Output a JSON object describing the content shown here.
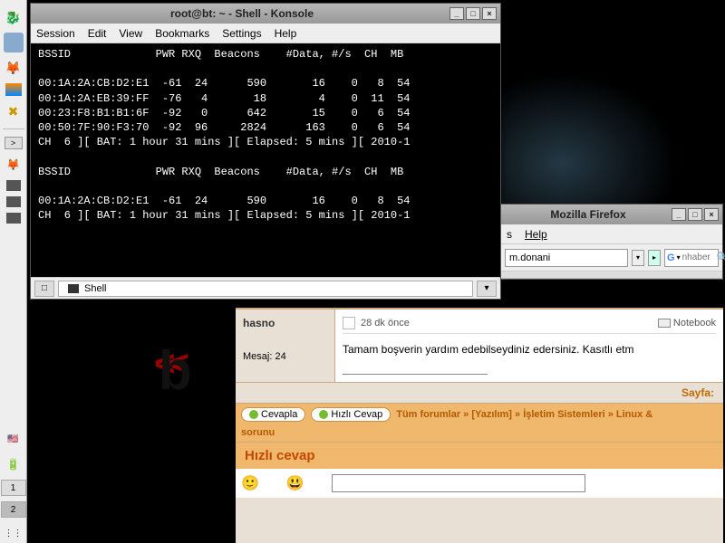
{
  "taskbar": {
    "desktops": [
      "1",
      "2"
    ]
  },
  "konsole": {
    "title": "root@bt: ~ - Shell - Konsole",
    "menu": [
      "Session",
      "Edit",
      "View",
      "Bookmarks",
      "Settings",
      "Help"
    ],
    "tab": "Shell",
    "lines": [
      "BSSID             PWR RXQ  Beacons    #Data, #/s  CH  MB",
      "",
      "00:1A:2A:CB:D2:E1  -61  24      590       16    0   8  54",
      "00:1A:2A:EB:39:FF  -76   4       18        4    0  11  54",
      "00:23:F8:B1:B1:6F  -92   0      642       15    0   6  54",
      "00:50:7F:90:F3:70  -92  96     2824      163    0   6  54",
      "CH  6 ][ BAT: 1 hour 31 mins ][ Elapsed: 5 mins ][ 2010-1",
      "",
      "BSSID             PWR RXQ  Beacons    #Data, #/s  CH  MB",
      "",
      "00:1A:2A:CB:D2:E1  -61  24      590       16    0   8  54",
      "CH  6 ][ BAT: 1 hour 31 mins ][ Elapsed: 5 mins ][ 2010-1"
    ]
  },
  "firefox": {
    "title": "Mozilla Firefox",
    "menu": [
      "s",
      "Help"
    ],
    "url": "m.donani",
    "search_placeholder": "nhaber"
  },
  "forum": {
    "username": "hasno",
    "msg_label": "Mesaj: 24",
    "time_ago": "28 dk önce",
    "notebook": "Notebook",
    "post_body": "Tamam boşverin yardım edebilseydiniz edersiniz. Kasıtlı etm",
    "page_label": "Sayfa:",
    "btn_reply": "Cevapla",
    "btn_quick": "Hızlı Cevap",
    "breadcrumb": "Tüm forumlar » [Yazılım] » İşletim Sistemleri » Linux &",
    "breadcrumb2": "sorunu",
    "quick_reply_header": "Hızlı cevap"
  }
}
